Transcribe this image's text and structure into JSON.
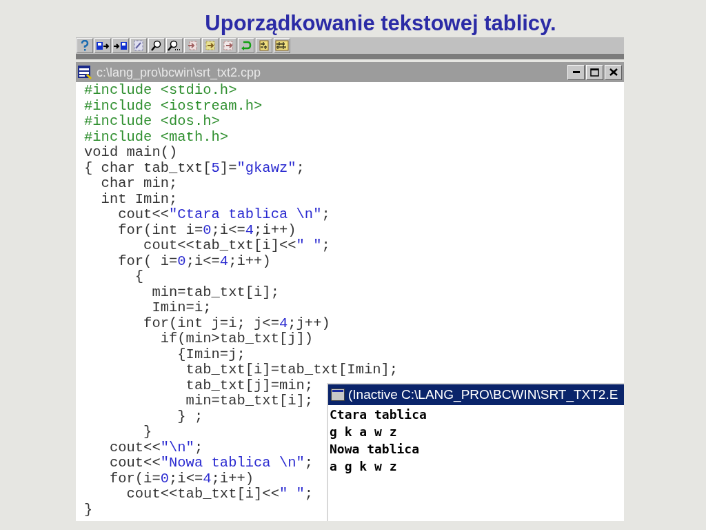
{
  "slide_title": "Uporządkowanie tekstowej tablicy.",
  "editor": {
    "title": "c:\\lang_pro\\bcwin\\srt_txt2.cpp",
    "active": false,
    "lines": [
      [
        {
          "kind": "include",
          "text": "#include <stdio.h>"
        }
      ],
      [
        {
          "kind": "include",
          "text": "#include <iostream.h>"
        }
      ],
      [
        {
          "kind": "include",
          "text": "#include <dos.h>"
        }
      ],
      [
        {
          "kind": "include",
          "text": "#include <math.h>"
        }
      ],
      [
        {
          "kind": "plain",
          "text": "void main()"
        }
      ],
      [
        {
          "kind": "plain",
          "text": "{ char tab_txt["
        },
        {
          "kind": "literal",
          "text": "5"
        },
        {
          "kind": "plain",
          "text": "]="
        },
        {
          "kind": "literal",
          "text": "\"gkawz\""
        },
        {
          "kind": "plain",
          "text": ";"
        }
      ],
      [
        {
          "kind": "plain",
          "text": "  char min;"
        }
      ],
      [
        {
          "kind": "plain",
          "text": "  int Imin;"
        }
      ],
      [
        {
          "kind": "plain",
          "text": "    cout<<"
        },
        {
          "kind": "literal",
          "text": "\"Ctara tablica \\n\""
        },
        {
          "kind": "plain",
          "text": ";"
        }
      ],
      [
        {
          "kind": "plain",
          "text": "    for(int i="
        },
        {
          "kind": "literal",
          "text": "0"
        },
        {
          "kind": "plain",
          "text": ";i<="
        },
        {
          "kind": "literal",
          "text": "4"
        },
        {
          "kind": "plain",
          "text": ";i++)"
        }
      ],
      [
        {
          "kind": "plain",
          "text": "       cout<<tab_txt[i]<<"
        },
        {
          "kind": "literal",
          "text": "\" \""
        },
        {
          "kind": "plain",
          "text": ";"
        }
      ],
      [
        {
          "kind": "plain",
          "text": "    for( i="
        },
        {
          "kind": "literal",
          "text": "0"
        },
        {
          "kind": "plain",
          "text": ";i<="
        },
        {
          "kind": "literal",
          "text": "4"
        },
        {
          "kind": "plain",
          "text": ";i++)"
        }
      ],
      [
        {
          "kind": "plain",
          "text": "      {"
        }
      ],
      [
        {
          "kind": "plain",
          "text": "        min=tab_txt[i];"
        }
      ],
      [
        {
          "kind": "plain",
          "text": "        Imin=i;"
        }
      ],
      [
        {
          "kind": "plain",
          "text": "       for(int j=i; j<="
        },
        {
          "kind": "literal",
          "text": "4"
        },
        {
          "kind": "plain",
          "text": ";j++)"
        }
      ],
      [
        {
          "kind": "plain",
          "text": "         if(min>tab_txt[j])"
        }
      ],
      [
        {
          "kind": "plain",
          "text": "           {Imin=j;"
        }
      ],
      [
        {
          "kind": "plain",
          "text": "            tab_txt[i]=tab_txt[Imin];"
        }
      ],
      [
        {
          "kind": "plain",
          "text": "            tab_txt[j]=min;"
        }
      ],
      [
        {
          "kind": "plain",
          "text": "            min=tab_txt[i];"
        }
      ],
      [
        {
          "kind": "plain",
          "text": "           } ;"
        }
      ],
      [
        {
          "kind": "plain",
          "text": "       }"
        }
      ],
      [
        {
          "kind": "plain",
          "text": "   cout<<"
        },
        {
          "kind": "literal",
          "text": "\"\\n\""
        },
        {
          "kind": "plain",
          "text": ";"
        }
      ],
      [
        {
          "kind": "plain",
          "text": "   cout<<"
        },
        {
          "kind": "literal",
          "text": "\"Nowa tablica \\n\""
        },
        {
          "kind": "plain",
          "text": ";"
        }
      ],
      [
        {
          "kind": "plain",
          "text": "   for(i="
        },
        {
          "kind": "literal",
          "text": "0"
        },
        {
          "kind": "plain",
          "text": ";i<="
        },
        {
          "kind": "literal",
          "text": "4"
        },
        {
          "kind": "plain",
          "text": ";i++)"
        }
      ],
      [
        {
          "kind": "plain",
          "text": "     cout<<tab_txt[i]<<"
        },
        {
          "kind": "literal",
          "text": "\" \""
        },
        {
          "kind": "plain",
          "text": ";"
        }
      ],
      [
        {
          "kind": "plain",
          "text": "}"
        }
      ]
    ]
  },
  "console": {
    "title": "(Inactive C:\\LANG_PRO\\BCWIN\\SRT_TXT2.E",
    "active": true,
    "lines": [
      "Ctara tablica",
      "g k a w z",
      "Nowa tablica",
      "a g k w z"
    ]
  }
}
